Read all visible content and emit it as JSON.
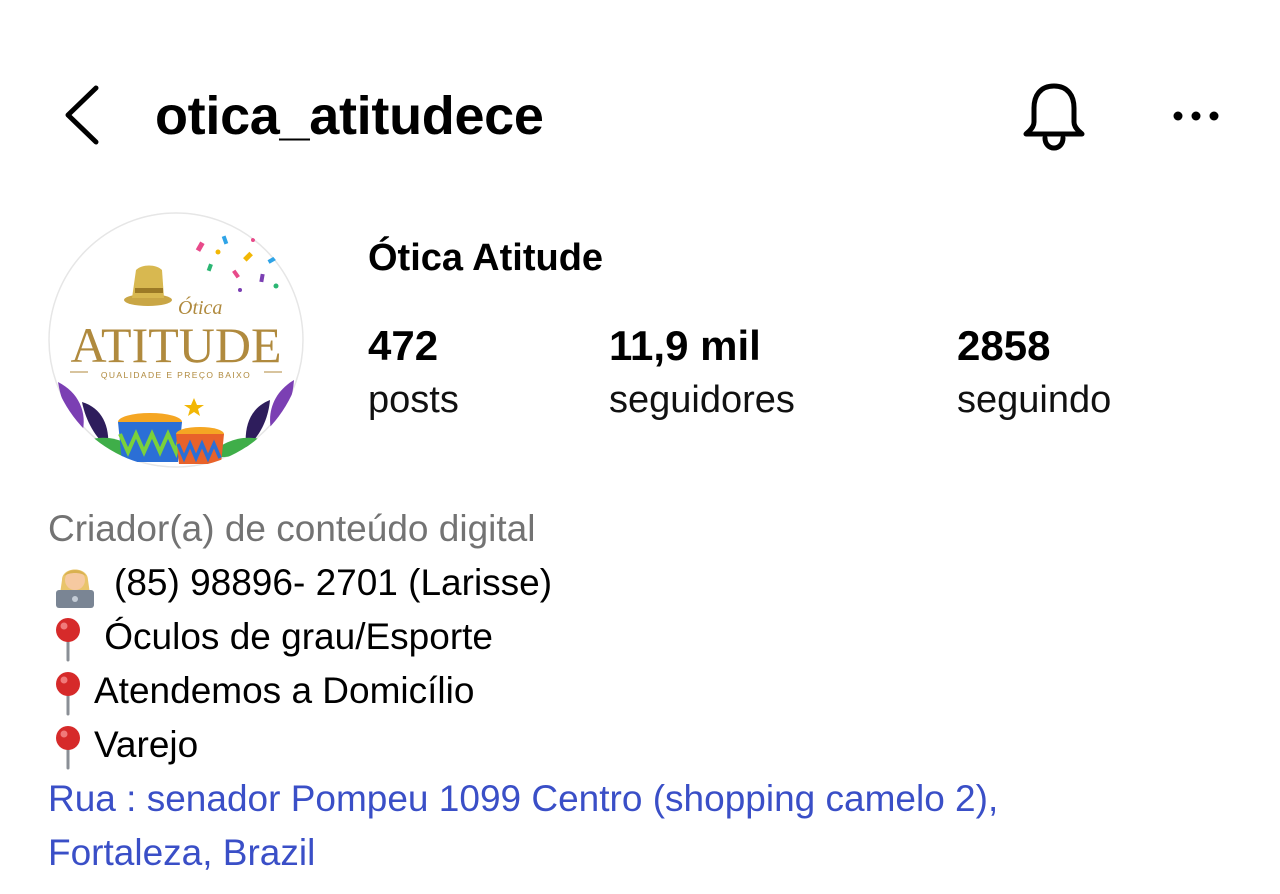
{
  "header": {
    "username": "otica_atitudece",
    "back_icon": "chevron-left-icon",
    "bell_icon": "bell-icon",
    "more_icon": "more-horizontal-icon"
  },
  "profile": {
    "display_name": "Ótica Atitude",
    "avatar": {
      "logo_small": "Ótica",
      "logo_big": "ATITUDE",
      "logo_tagline": "QUALIDADE E PREÇO BAIXO"
    },
    "stats": {
      "posts": {
        "value": "472",
        "label": "posts"
      },
      "followers": {
        "value": "11,9 mil",
        "label": "seguidores"
      },
      "following": {
        "value": "2858",
        "label": "seguindo"
      }
    }
  },
  "bio": {
    "category": "Criador(a) de conteúdo digital",
    "lines": [
      {
        "icon": "woman-technologist-emoji",
        "text": "(85) 98896- 2701 (Larisse)"
      },
      {
        "icon": "round-pushpin-emoji",
        "text": " Óculos de grau/Esporte"
      },
      {
        "icon": "round-pushpin-emoji",
        "text": "Atendemos a Domicílio"
      },
      {
        "icon": "round-pushpin-emoji",
        "text": "Varejo"
      }
    ],
    "address_line1": "Rua : senador Pompeu 1099 Centro (shopping camelo 2),",
    "address_line2": "Fortaleza, Brazil"
  },
  "colors": {
    "text": "#000000",
    "secondary_text": "#737373",
    "link": "#3a4fc7",
    "logo_gold": "#b08a3e"
  }
}
